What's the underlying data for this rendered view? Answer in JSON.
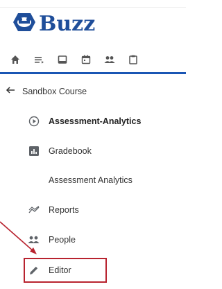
{
  "brand": {
    "name": "Buzz"
  },
  "toolbar": {
    "icons": [
      "home-icon",
      "list-icon",
      "document-icon",
      "calendar-icon",
      "people-icon",
      "clipboard-icon"
    ]
  },
  "nav": {
    "back_label": "Sandbox Course",
    "items": [
      {
        "label": "Assessment-Analytics",
        "icon": "play-circle-icon",
        "active": true
      },
      {
        "label": "Gradebook",
        "icon": "bar-chart-icon"
      },
      {
        "label": "Assessment Analytics",
        "icon": ""
      },
      {
        "label": "Reports",
        "icon": "reports-icon"
      },
      {
        "label": "People",
        "icon": "people-icon"
      },
      {
        "label": "Editor",
        "icon": "pencil-icon",
        "highlighted": true
      }
    ]
  },
  "colors": {
    "brand": "#1f4e9a",
    "accent_rule": "#1a56b4",
    "highlight": "#b8232f",
    "icon": "#5f6368"
  }
}
